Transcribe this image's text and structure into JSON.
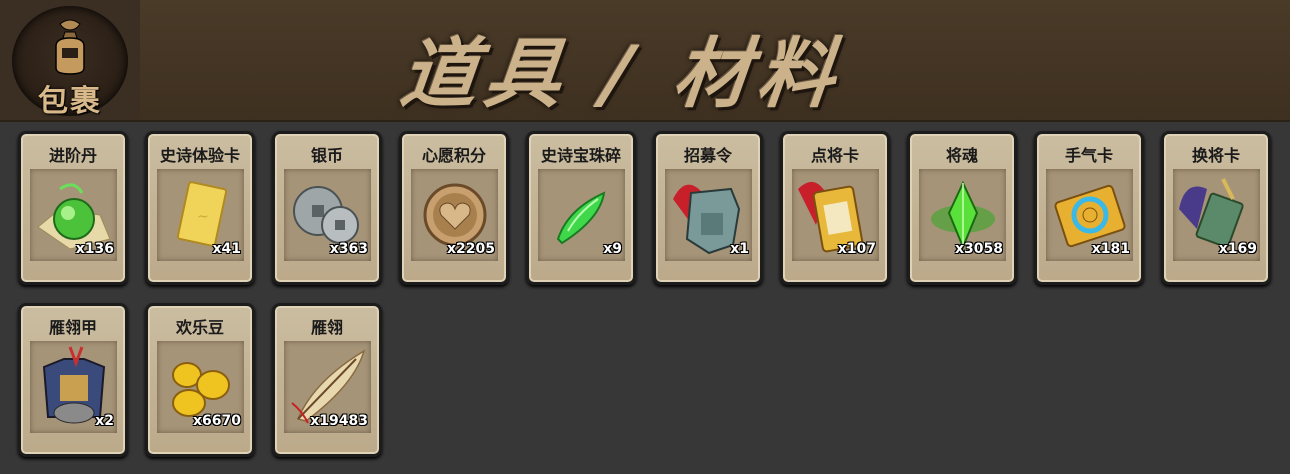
{
  "header": {
    "logo_label": "包裹",
    "title": "道具 / 材料"
  },
  "items": [
    {
      "label": "进阶丹",
      "count": "x136",
      "icon": "green-orb-icon"
    },
    {
      "label": "史诗体验卡",
      "count": "x41",
      "icon": "gold-card-icon"
    },
    {
      "label": "银币",
      "count": "x363",
      "icon": "silver-coins-icon"
    },
    {
      "label": "心愿积分",
      "count": "x2205",
      "icon": "heart-coin-icon"
    },
    {
      "label": "史诗宝珠碎",
      "count": "x9",
      "icon": "green-shard-icon"
    },
    {
      "label": "招募令",
      "count": "x1",
      "icon": "recruit-token-icon"
    },
    {
      "label": "点将卡",
      "count": "x107",
      "icon": "general-card-icon"
    },
    {
      "label": "将魂",
      "count": "x3058",
      "icon": "soul-crystal-icon"
    },
    {
      "label": "手气卡",
      "count": "x181",
      "icon": "luck-card-icon"
    },
    {
      "label": "换将卡",
      "count": "x169",
      "icon": "swap-card-icon"
    },
    {
      "label": "雁翎甲",
      "count": "x2",
      "icon": "armor-icon"
    },
    {
      "label": "欢乐豆",
      "count": "x6670",
      "icon": "gold-beans-icon"
    },
    {
      "label": "雁翎",
      "count": "x19483",
      "icon": "feather-icon"
    }
  ]
}
